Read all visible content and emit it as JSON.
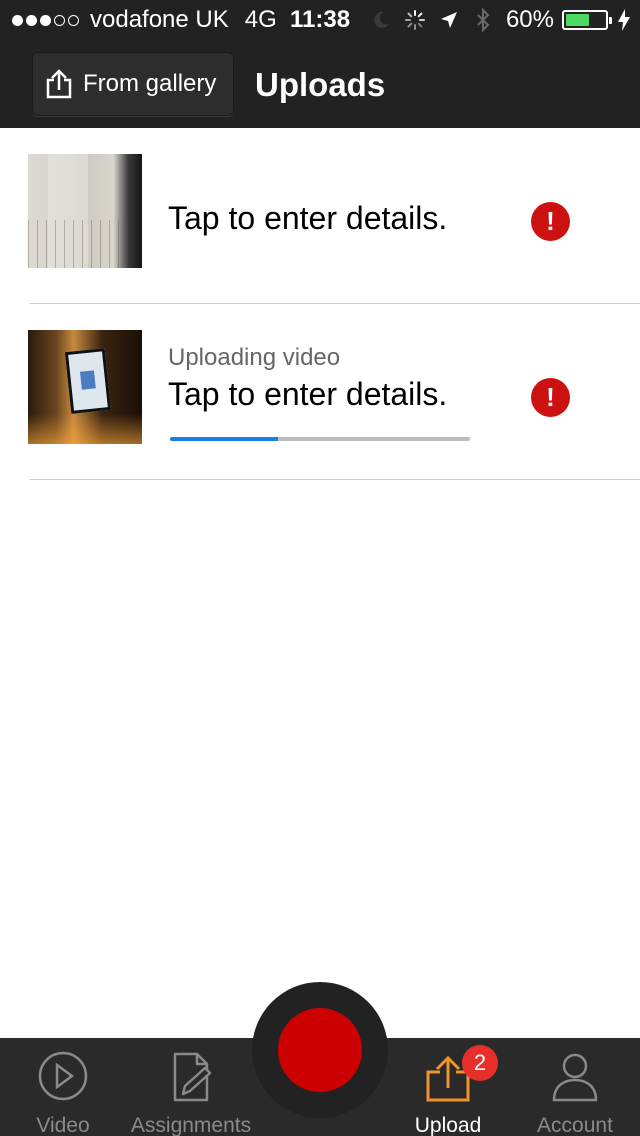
{
  "status_bar": {
    "signal_bars": 3,
    "signal_total": 5,
    "carrier": "vodafone UK",
    "network": "4G",
    "time": "11:38",
    "battery_percent": "60%",
    "battery_level": 0.6,
    "icons": [
      "moon-icon",
      "activity-spinner-icon",
      "location-arrow-icon",
      "bluetooth-icon",
      "charging-bolt-icon"
    ]
  },
  "header": {
    "gallery_button": {
      "label": "From gallery",
      "icon": "upload-icon"
    },
    "title": "Uploads"
  },
  "uploads": [
    {
      "thumbnail": "video-thumbnail",
      "status": "",
      "details": "Tap to enter details.",
      "alert_symbol": "!",
      "progress": null
    },
    {
      "thumbnail": "video-thumbnail",
      "status": "Uploading video",
      "details": "Tap to enter details.",
      "alert_symbol": "!",
      "progress": 0.36
    }
  ],
  "tab_bar": {
    "tabs": [
      {
        "label": "Video",
        "icon": "play-circle-icon",
        "active": false
      },
      {
        "label": "Assignments",
        "icon": "document-edit-icon",
        "active": false
      },
      {
        "label": "Upload",
        "icon": "upload-icon",
        "active": true,
        "badge": "2"
      },
      {
        "label": "Account",
        "icon": "person-icon",
        "active": false
      }
    ],
    "record_button": {
      "icon": "record-icon",
      "color": "#cc0000"
    }
  },
  "colors": {
    "bar_background": "#222222",
    "accent_orange": "#f0932b",
    "alert_red": "#cc1111",
    "progress_blue": "#1a7fe0",
    "battery_green": "#4cd964"
  }
}
